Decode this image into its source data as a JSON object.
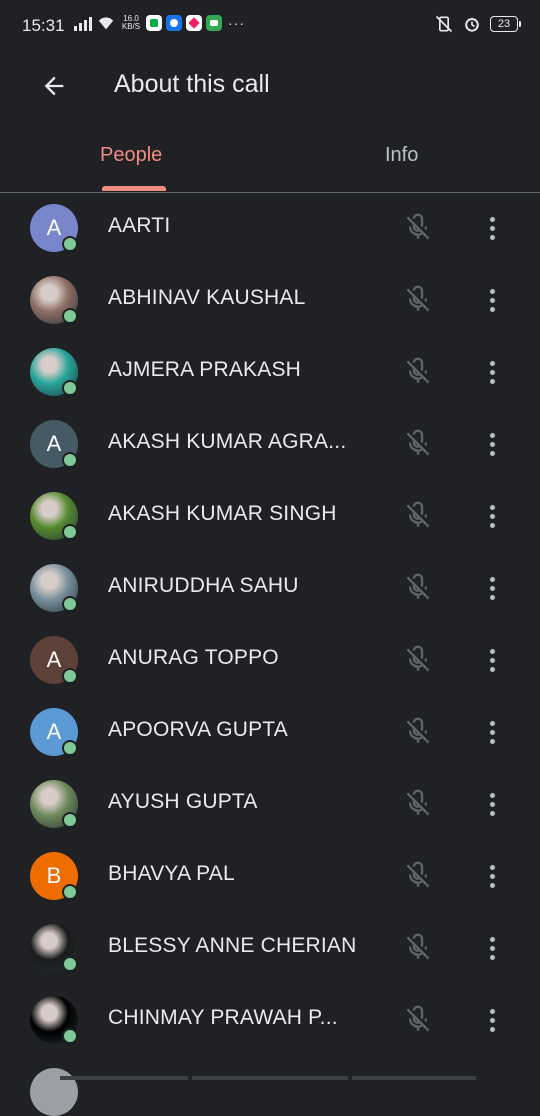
{
  "status_bar": {
    "time": "15:31",
    "speed_top": "16.0",
    "speed_bottom": "KB/S",
    "overflow": "···",
    "battery": "23"
  },
  "app_bar": {
    "title": "About this call",
    "back_icon": "arrow-back-icon"
  },
  "tabs": [
    {
      "label": "People",
      "selected": true
    },
    {
      "label": "Info",
      "selected": false
    }
  ],
  "colors": {
    "background": "#202124",
    "accent": "#f28b82",
    "presence": "#81c995"
  },
  "participants": [
    {
      "name": "AARTI",
      "initial": "A",
      "avatar_color": "#7986cb",
      "photo": false
    },
    {
      "name": "ABHINAV KAUSHAL",
      "initial": "",
      "avatar_color": "#8d6e63",
      "photo": true
    },
    {
      "name": "AJMERA PRAKASH",
      "initial": "",
      "avatar_color": "#26a69a",
      "photo": true
    },
    {
      "name": "AKASH KUMAR AGRA...",
      "initial": "A",
      "avatar_color": "#455a64",
      "photo": false
    },
    {
      "name": "AKASH KUMAR SINGH",
      "initial": "",
      "avatar_color": "#558b2f",
      "photo": true
    },
    {
      "name": "ANIRUDDHA SAHU",
      "initial": "",
      "avatar_color": "#78909c",
      "photo": true
    },
    {
      "name": "ANURAG TOPPO",
      "initial": "A",
      "avatar_color": "#5d4037",
      "photo": false
    },
    {
      "name": "APOORVA GUPTA",
      "initial": "A",
      "avatar_color": "#5c9ad6",
      "photo": false
    },
    {
      "name": "AYUSH GUPTA",
      "initial": "",
      "avatar_color": "#6d8a5a",
      "photo": true
    },
    {
      "name": "BHAVYA PAL",
      "initial": "B",
      "avatar_color": "#ef6c00",
      "photo": false
    },
    {
      "name": "BLESSY ANNE CHERIAN",
      "initial": "",
      "avatar_color": "#1a1a1a",
      "photo": true
    },
    {
      "name": "CHINMAY PRAWAH P...",
      "initial": "",
      "avatar_color": "#000000",
      "photo": true
    }
  ]
}
